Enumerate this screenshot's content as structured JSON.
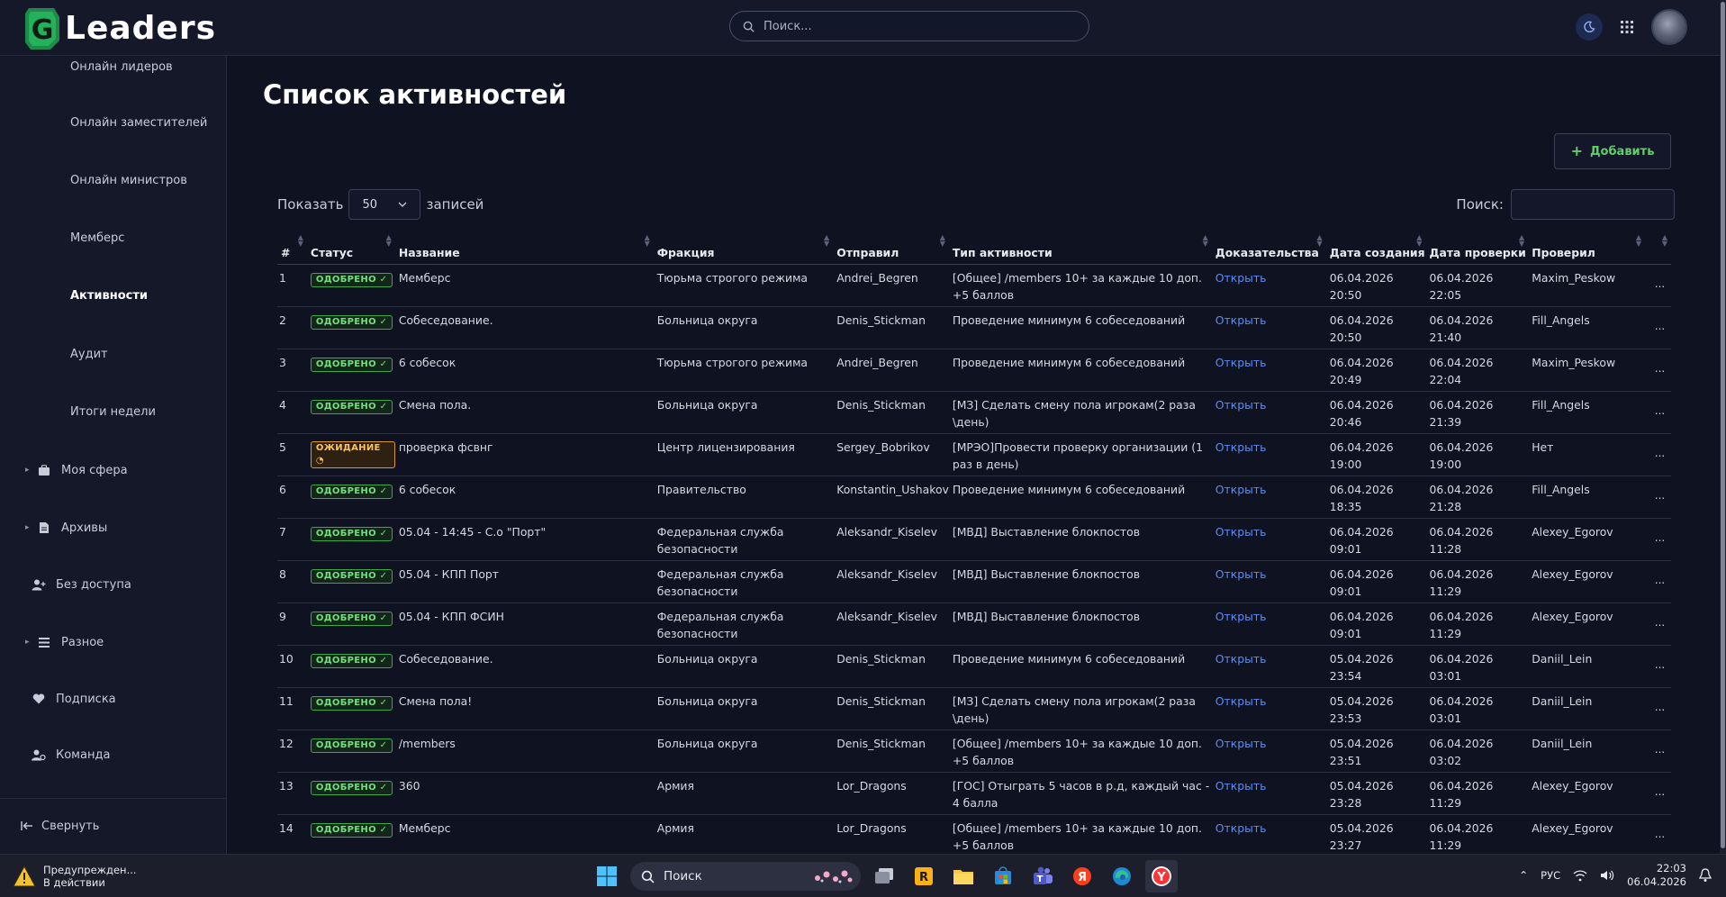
{
  "app": {
    "name": "Leaders",
    "logo_letter": "G"
  },
  "topbar": {
    "search_placeholder": "Поиск..."
  },
  "sidebar": {
    "sub_items": [
      {
        "label": "Онлайн лидеров"
      },
      {
        "label": "Онлайн заместителей"
      },
      {
        "label": "Онлайн министров"
      },
      {
        "label": "Мемберс"
      },
      {
        "label": "Активности",
        "active": true
      },
      {
        "label": "Аудит"
      },
      {
        "label": "Итоги недели"
      }
    ],
    "sections": [
      {
        "label": "Моя сфера",
        "icon": "briefcase-icon"
      },
      {
        "label": "Архивы",
        "icon": "document-icon"
      },
      {
        "label": "Без доступа",
        "icon": "user-plus-icon"
      },
      {
        "label": "Разное",
        "icon": "list-icon"
      },
      {
        "label": "Подписка",
        "icon": "heart-icon"
      },
      {
        "label": "Команда",
        "icon": "users-icon"
      }
    ],
    "collapse_label": "Свернуть"
  },
  "main": {
    "title": "Список активностей",
    "add_button": "Добавить",
    "show_label": "Показать",
    "show_value": "50",
    "records_label": "записей",
    "search_label": "Поиск:"
  },
  "table": {
    "headers": [
      "#",
      "Статус",
      "Название",
      "Фракция",
      "Отправил",
      "Тип активности",
      "Доказательства",
      "Дата создания",
      "Дата проверки",
      "Проверил",
      ""
    ],
    "rows": [
      {
        "n": "1",
        "status": "ОДОБРЕНО",
        "status_type": "ok",
        "name": "Мемберс",
        "faction": "Тюрьма строгого режима",
        "sender": "Andrei_Begren",
        "type": "[Общее] /members 10+ за каждые 10 доп. +5 баллов",
        "proof": "Открыть",
        "created": "06.04.2026 20:50",
        "checked": "06.04.2026 22:05",
        "checker": "Maxim_Peskow"
      },
      {
        "n": "2",
        "status": "ОДОБРЕНО",
        "status_type": "ok",
        "name": "Собеседование.",
        "faction": "Больница округа",
        "sender": "Denis_Stickman",
        "type": "Проведение минимум 6 собеседований",
        "proof": "Открыть",
        "created": "06.04.2026 20:50",
        "checked": "06.04.2026 21:40",
        "checker": "Fill_Angels"
      },
      {
        "n": "3",
        "status": "ОДОБРЕНО",
        "status_type": "ok",
        "name": "6 собесок",
        "faction": "Тюрьма строгого режима",
        "sender": "Andrei_Begren",
        "type": "Проведение минимум 6 собеседований",
        "proof": "Открыть",
        "created": "06.04.2026 20:49",
        "checked": "06.04.2026 22:04",
        "checker": "Maxim_Peskow"
      },
      {
        "n": "4",
        "status": "ОДОБРЕНО",
        "status_type": "ok",
        "name": "Смена пола.",
        "faction": "Больница округа",
        "sender": "Denis_Stickman",
        "type": "[МЗ] Сделать смену пола игрокам(2 раза \\день)",
        "proof": "Открыть",
        "created": "06.04.2026 20:46",
        "checked": "06.04.2026 21:39",
        "checker": "Fill_Angels"
      },
      {
        "n": "5",
        "status": "ОЖИДАНИЕ",
        "status_type": "wait",
        "name": "проверка фсвнг",
        "faction": "Центр лицензирования",
        "sender": "Sergey_Bobrikov",
        "type": "[МРЭО]Провести проверку организации (1 раз в день)",
        "proof": "Открыть",
        "created": "06.04.2026 19:00",
        "checked": "06.04.2026 19:00",
        "checker": "Нет"
      },
      {
        "n": "6",
        "status": "ОДОБРЕНО",
        "status_type": "ok",
        "name": "6 собесок",
        "faction": "Правительство",
        "sender": "Konstantin_Ushakov",
        "type": "Проведение минимум 6 собеседований",
        "proof": "Открыть",
        "created": "06.04.2026 18:35",
        "checked": "06.04.2026 21:28",
        "checker": "Fill_Angels"
      },
      {
        "n": "7",
        "status": "ОДОБРЕНО",
        "status_type": "ok",
        "name": "05.04 - 14:45 - С.о \"Порт\"",
        "faction": "Федеральная служба безопасности",
        "sender": "Aleksandr_Kiselev",
        "type": "[МВД] Выставление блокпостов",
        "proof": "Открыть",
        "created": "06.04.2026 09:01",
        "checked": "06.04.2026 11:28",
        "checker": "Alexey_Egorov"
      },
      {
        "n": "8",
        "status": "ОДОБРЕНО",
        "status_type": "ok",
        "name": "05.04 - КПП Порт",
        "faction": "Федеральная служба безопасности",
        "sender": "Aleksandr_Kiselev",
        "type": "[МВД] Выставление блокпостов",
        "proof": "Открыть",
        "created": "06.04.2026 09:01",
        "checked": "06.04.2026 11:29",
        "checker": "Alexey_Egorov"
      },
      {
        "n": "9",
        "status": "ОДОБРЕНО",
        "status_type": "ok",
        "name": "05.04 - КПП ФСИН",
        "faction": "Федеральная служба безопасности",
        "sender": "Aleksandr_Kiselev",
        "type": "[МВД] Выставление блокпостов",
        "proof": "Открыть",
        "created": "06.04.2026 09:01",
        "checked": "06.04.2026 11:29",
        "checker": "Alexey_Egorov"
      },
      {
        "n": "10",
        "status": "ОДОБРЕНО",
        "status_type": "ok",
        "name": "Собеседование.",
        "faction": "Больница округа",
        "sender": "Denis_Stickman",
        "type": "Проведение минимум 6 собеседований",
        "proof": "Открыть",
        "created": "05.04.2026 23:54",
        "checked": "06.04.2026 03:01",
        "checker": "Daniil_Lein"
      },
      {
        "n": "11",
        "status": "ОДОБРЕНО",
        "status_type": "ok",
        "name": "Смена пола!",
        "faction": "Больница округа",
        "sender": "Denis_Stickman",
        "type": "[МЗ] Сделать смену пола игрокам(2 раза \\день)",
        "proof": "Открыть",
        "created": "05.04.2026 23:53",
        "checked": "06.04.2026 03:01",
        "checker": "Daniil_Lein"
      },
      {
        "n": "12",
        "status": "ОДОБРЕНО",
        "status_type": "ok",
        "name": "/members",
        "faction": "Больница округа",
        "sender": "Denis_Stickman",
        "type": "[Общее] /members 10+ за каждые 10 доп. +5 баллов",
        "proof": "Открыть",
        "created": "05.04.2026 23:51",
        "checked": "06.04.2026 03:02",
        "checker": "Daniil_Lein"
      },
      {
        "n": "13",
        "status": "ОДОБРЕНО",
        "status_type": "ok",
        "name": "360",
        "faction": "Армия",
        "sender": "Lor_Dragons",
        "type": "[ГОС] Отыграть 5 часов в р.д, каждый час - 4 балла",
        "proof": "Открыть",
        "created": "05.04.2026 23:28",
        "checked": "06.04.2026 11:29",
        "checker": "Alexey_Egorov"
      },
      {
        "n": "14",
        "status": "ОДОБРЕНО",
        "status_type": "ok",
        "name": "Мемберс",
        "faction": "Армия",
        "sender": "Lor_Dragons",
        "type": "[Общее] /members 10+ за каждые 10 доп. +5 баллов",
        "proof": "Открыть",
        "created": "05.04.2026 23:27",
        "checked": "06.04.2026 11:29",
        "checker": "Alexey_Egorov"
      }
    ],
    "row_action": "..."
  },
  "taskbar": {
    "warning_title": "Предупрежден...",
    "warning_sub": "В действии",
    "search_label": "Поиск",
    "lang": "РУС",
    "time": "22:03",
    "date": "06.04.2026"
  },
  "colors": {
    "approved": "#6fe07a",
    "pending": "#ffc25a",
    "link": "#5c8df6",
    "accent_add": "#5fcf6a"
  }
}
